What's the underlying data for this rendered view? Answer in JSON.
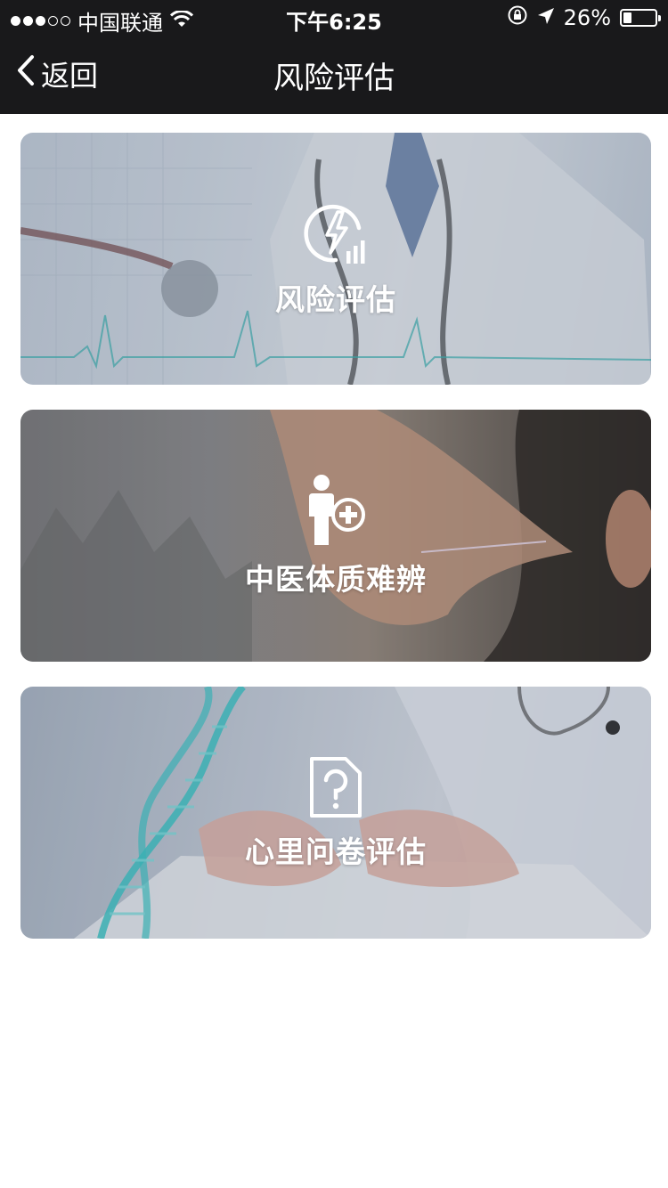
{
  "status_bar": {
    "carrier": "中国联通",
    "time": "下午6:25",
    "battery_percent": "26%",
    "battery_level": 0.26,
    "signal_bars_filled": 3,
    "signal_bars_total": 5
  },
  "nav": {
    "back_label": "返回",
    "title": "风险评估"
  },
  "cards": [
    {
      "label": "风险评估",
      "icon": "lightning-chart-icon"
    },
    {
      "label": "中医体质难辨",
      "icon": "person-plus-icon"
    },
    {
      "label": "心里问卷评估",
      "icon": "question-document-icon"
    }
  ],
  "colors": {
    "bar_bg": "#19191b",
    "text_on_card": "#ffffff",
    "page_bg": "#ffffff"
  }
}
